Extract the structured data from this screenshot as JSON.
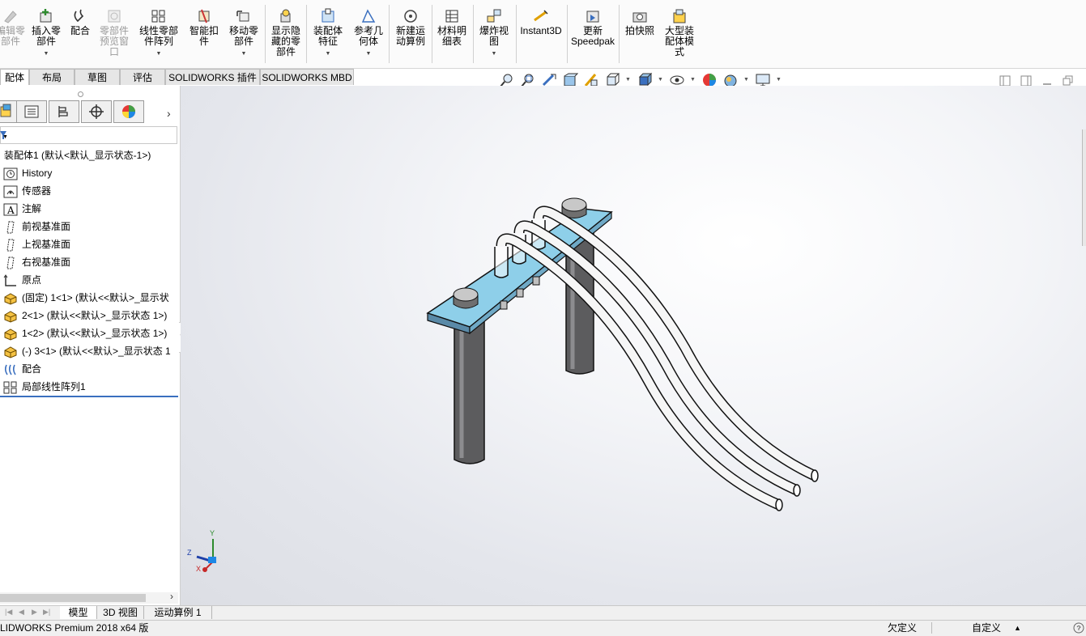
{
  "ribbon": {
    "buttons": [
      {
        "label": "编辑零\n部件",
        "icon": "edit-part-icon",
        "disabled": true
      },
      {
        "label": "插入零\n部件",
        "icon": "insert-component-icon",
        "caret": true
      },
      {
        "label": "配合",
        "icon": "mate-icon"
      },
      {
        "label": "零部件\n预览窗\n口",
        "icon": "component-preview-icon",
        "disabled": true
      },
      {
        "label": "线性零部\n件阵列",
        "icon": "linear-pattern-icon",
        "caret": true
      },
      {
        "label": "智能扣\n件",
        "icon": "smart-fasteners-icon"
      },
      {
        "label": "移动零\n部件",
        "icon": "move-component-icon",
        "caret": true
      },
      {
        "label": "显示隐\n藏的零\n部件",
        "icon": "show-hidden-icon"
      },
      {
        "label": "装配体\n特征",
        "icon": "assembly-features-icon",
        "caret": true
      },
      {
        "label": "参考几\n何体",
        "icon": "reference-geometry-icon",
        "caret": true
      },
      {
        "label": "新建运\n动算例",
        "icon": "new-motion-study-icon"
      },
      {
        "label": "材料明\n细表",
        "icon": "bom-icon"
      },
      {
        "label": "爆炸视\n图",
        "icon": "exploded-view-icon",
        "caret": true
      },
      {
        "label": "Instant3D",
        "icon": "instant3d-icon"
      },
      {
        "label": "更新\nSpeedpak",
        "icon": "speedpak-icon"
      },
      {
        "label": "拍快照",
        "icon": "snapshot-icon"
      },
      {
        "label": "大型装\n配体模\n式",
        "icon": "large-assembly-icon"
      }
    ]
  },
  "tabs": [
    "配体",
    "布局",
    "草图",
    "评估",
    "SOLIDWORKS 插件",
    "SOLIDWORKS MBD"
  ],
  "tree": {
    "root": "装配体1  (默认<默认_显示状态-1>)",
    "items": [
      {
        "label": "History",
        "icon": "history-icon"
      },
      {
        "label": "传感器",
        "icon": "sensor-icon"
      },
      {
        "label": "注解",
        "icon": "annotation-icon"
      },
      {
        "label": "前视基准面",
        "icon": "plane-icon"
      },
      {
        "label": "上视基准面",
        "icon": "plane-icon"
      },
      {
        "label": "右视基准面",
        "icon": "plane-icon"
      },
      {
        "label": "原点",
        "icon": "origin-icon"
      },
      {
        "label": "(固定) 1<1> (默认<<默认>_显示状",
        "icon": "part-icon"
      },
      {
        "label": "2<1> (默认<<默认>_显示状态 1>)",
        "icon": "part-icon"
      },
      {
        "label": "1<2> (默认<<默认>_显示状态 1>)",
        "icon": "part-icon"
      },
      {
        "label": "(-) 3<1> (默认<<默认>_显示状态 1",
        "icon": "part-icon"
      },
      {
        "label": "配合",
        "icon": "mates-folder-icon"
      },
      {
        "label": "局部线性阵列1",
        "icon": "pattern-icon"
      }
    ]
  },
  "triad": {
    "x": "X",
    "y": "Y",
    "z": "Z"
  },
  "bottom_tabs": [
    "模型",
    "3D 视图",
    "运动算例 1"
  ],
  "status": {
    "product": "LIDWORKS Premium 2018 x64 版",
    "underdefined": "欠定义",
    "custom": "自定义"
  },
  "colors": {
    "plate": "#8ecfe9",
    "post": "#5c5c5e",
    "accent": "#3a6fbf"
  }
}
